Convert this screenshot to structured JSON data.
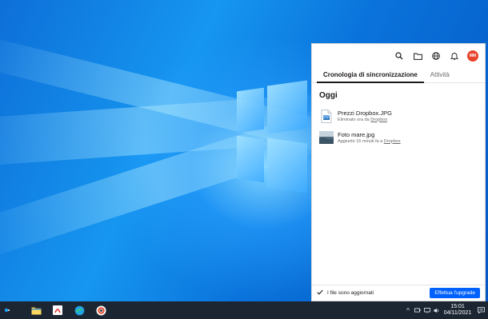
{
  "panel": {
    "tabs": [
      {
        "label": "Cronologia di sincronizzazione",
        "active": true
      },
      {
        "label": "Attività",
        "active": false
      }
    ],
    "avatar_initials": "MM",
    "section_title": "Oggi",
    "files": [
      {
        "name": "Prezzi Dropbox.JPG",
        "meta_prefix": "Eliminato ora da ",
        "meta_link": "Dropbox",
        "icon": "document-icon"
      },
      {
        "name": "Foto mare.jpg",
        "meta_prefix": "Aggiunto 16 minuti fa a ",
        "meta_link": "Dropbox",
        "icon": "image-thumbnail"
      }
    ],
    "status_text": "I file sono aggiornati",
    "upgrade_label": "Effettua l'upgrade"
  },
  "taskbar": {
    "icons": [
      "windows-start-icon",
      "file-explorer-icon",
      "acrobat-icon",
      "edge-icon",
      "chrome-icon"
    ],
    "time": "15:01",
    "date": "04/11/2021"
  },
  "colors": {
    "accent": "#0061fe",
    "avatar": "#e8432c",
    "taskbar": "#1c2633"
  }
}
